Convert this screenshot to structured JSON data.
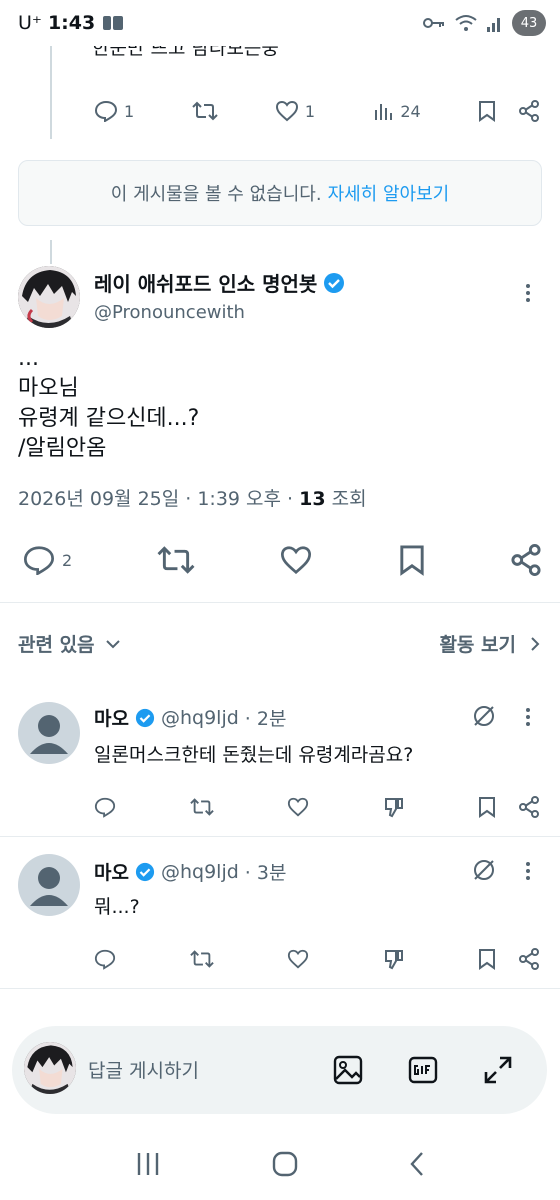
{
  "status_bar": {
    "time": "1:43",
    "carrier": "U⁺",
    "battery": "43"
  },
  "top_reply": {
    "text": "한눈만 뜨고 탐라보는중",
    "replies": "1",
    "likes": "1",
    "views": "24"
  },
  "unavailable": {
    "text": "이 게시물을 볼 수 없습니다.",
    "link": "자세히 알아보기"
  },
  "post": {
    "author_name": "레이 애쉬포드 인소 명언봇",
    "author_handle": "@Pronouncewith",
    "body_line1": "...",
    "body_line2": "마오님",
    "body_line3": "유령계 같으신데...?",
    "body_line4": "/알림안옴",
    "date": "2026년 09월 25일 · 1:39 오후 · ",
    "views_count": "13",
    "views_label": "조회",
    "reply_count": "2"
  },
  "related": {
    "label": "관련 있음",
    "activity": "활동 보기"
  },
  "replies": [
    {
      "name": "마오",
      "handle": "@hq9ljd",
      "time": "· 2분",
      "text": "일론머스크한테 돈줬는데 유령계라곰요?"
    },
    {
      "name": "마오",
      "handle": "@hq9ljd",
      "time": "· 3분",
      "text": "뭐...?"
    }
  ],
  "compose": {
    "placeholder": "답글 게시하기"
  },
  "colors": {
    "blue": "#1d9bf0",
    "muted": "#536471",
    "text": "#0f1419"
  }
}
